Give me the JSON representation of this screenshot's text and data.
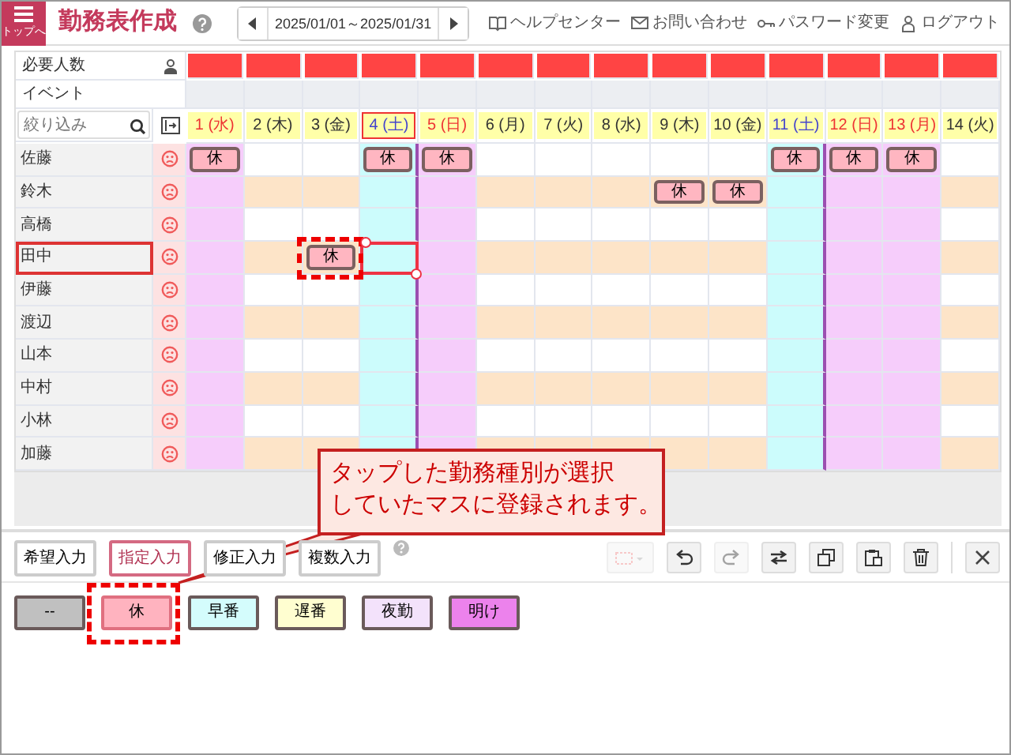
{
  "header": {
    "menu_label": "トップへ",
    "title": "勤務表作成",
    "date_range": "2025/01/01～2025/01/31",
    "links": [
      {
        "label": "ヘルプセンター",
        "kind": "help"
      },
      {
        "label": "お問い合わせ",
        "kind": "mail"
      },
      {
        "label": "パスワード変更",
        "kind": "key"
      },
      {
        "label": "ログアウト",
        "kind": "logout"
      }
    ]
  },
  "grid": {
    "required_label": "必要人数",
    "event_label": "イベント",
    "filter_placeholder": "絞り込み",
    "days": [
      {
        "label": "1 (水)",
        "kind": "holiday",
        "selected": false
      },
      {
        "label": "2 (木)",
        "kind": "weekday",
        "selected": false
      },
      {
        "label": "3 (金)",
        "kind": "weekday",
        "selected": false
      },
      {
        "label": "4 (土)",
        "kind": "saturday",
        "selected": true
      },
      {
        "label": "5 (日)",
        "kind": "sunday",
        "selected": false
      },
      {
        "label": "6 (月)",
        "kind": "weekday",
        "selected": false
      },
      {
        "label": "7 (火)",
        "kind": "weekday",
        "selected": false
      },
      {
        "label": "8 (水)",
        "kind": "weekday",
        "selected": false
      },
      {
        "label": "9 (木)",
        "kind": "weekday",
        "selected": false
      },
      {
        "label": "10 (金)",
        "kind": "weekday",
        "selected": false
      },
      {
        "label": "11 (土)",
        "kind": "saturday",
        "selected": false
      },
      {
        "label": "12 (日)",
        "kind": "sunday",
        "selected": false
      },
      {
        "label": "13 (月)",
        "kind": "holiday",
        "selected": false
      },
      {
        "label": "14 (火)",
        "kind": "weekday",
        "selected": false
      }
    ],
    "staff": [
      {
        "name": "佐藤",
        "selected": false,
        "cells": [
          {
            "kind": "shift",
            "label": "休",
            "highlighted": false
          },
          {
            "kind": "blank"
          },
          {
            "kind": "blank"
          },
          {
            "kind": "shift",
            "label": "休",
            "highlighted": false
          },
          {
            "kind": "shift",
            "label": "休",
            "highlighted": false
          },
          {
            "kind": "blank"
          },
          {
            "kind": "blank"
          },
          {
            "kind": "blank"
          },
          {
            "kind": "blank"
          },
          {
            "kind": "blank"
          },
          {
            "kind": "shift",
            "label": "休",
            "highlighted": false
          },
          {
            "kind": "shift",
            "label": "休",
            "highlighted": false
          },
          {
            "kind": "shift",
            "label": "休",
            "highlighted": false
          },
          {
            "kind": "blank"
          }
        ]
      },
      {
        "name": "鈴木",
        "selected": false,
        "cells": [
          {
            "kind": "blank"
          },
          {
            "kind": "blank"
          },
          {
            "kind": "blank"
          },
          {
            "kind": "blank"
          },
          {
            "kind": "blank"
          },
          {
            "kind": "blank"
          },
          {
            "kind": "blank"
          },
          {
            "kind": "blank"
          },
          {
            "kind": "shift",
            "label": "休",
            "highlighted": false
          },
          {
            "kind": "shift",
            "label": "休",
            "highlighted": false
          },
          {
            "kind": "blank"
          },
          {
            "kind": "blank"
          },
          {
            "kind": "blank"
          },
          {
            "kind": "blank"
          }
        ]
      },
      {
        "name": "高橋",
        "selected": false
      },
      {
        "name": "田中",
        "selected": true,
        "cells": [
          {
            "kind": "blank"
          },
          {
            "kind": "blank"
          },
          {
            "kind": "shift",
            "label": "休",
            "highlighted": true
          },
          {
            "kind": "blank"
          },
          {
            "kind": "blank"
          },
          {
            "kind": "blank"
          },
          {
            "kind": "blank"
          },
          {
            "kind": "blank"
          },
          {
            "kind": "blank"
          },
          {
            "kind": "blank"
          },
          {
            "kind": "blank"
          },
          {
            "kind": "blank"
          },
          {
            "kind": "blank"
          },
          {
            "kind": "blank"
          }
        ]
      },
      {
        "name": "伊藤",
        "selected": false
      },
      {
        "name": "渡辺",
        "selected": false
      },
      {
        "name": "山本",
        "selected": false
      },
      {
        "name": "中村",
        "selected": false
      },
      {
        "name": "小林",
        "selected": false
      },
      {
        "name": "加藤",
        "selected": false
      }
    ]
  },
  "toolbar": {
    "modes": [
      {
        "label": "希望入力",
        "selected": false
      },
      {
        "label": "指定入力",
        "selected": true
      },
      {
        "label": "修正入力",
        "selected": false
      },
      {
        "label": "複数入力",
        "selected": false
      }
    ],
    "tools": [
      {
        "kind": "interval",
        "disabled": true
      },
      {
        "kind": "undo",
        "disabled": false
      },
      {
        "kind": "redo",
        "disabled": true
      },
      {
        "kind": "swap",
        "disabled": false
      },
      {
        "kind": "copy",
        "disabled": false
      },
      {
        "kind": "paste",
        "disabled": false
      },
      {
        "kind": "delete",
        "disabled": false
      },
      {
        "kind": "close",
        "disabled": false
      }
    ]
  },
  "shift_types": [
    {
      "label": "--",
      "color": "#c0c0c0",
      "selected": false,
      "highlighted": false
    },
    {
      "label": "休",
      "color": "#ffb3bf",
      "selected": true,
      "highlighted": true
    },
    {
      "label": "早番",
      "color": "#d4fcfc",
      "selected": false,
      "highlighted": false
    },
    {
      "label": "遅番",
      "color": "#fffed0",
      "selected": false,
      "highlighted": false
    },
    {
      "label": "夜勤",
      "color": "#f3e2fb",
      "selected": false,
      "highlighted": false
    },
    {
      "label": "明け",
      "color": "#ec82ec",
      "selected": false,
      "highlighted": false
    }
  ],
  "callout": {
    "lines": [
      "タップした勤務種別が選択",
      "していたマスに登録されます。"
    ]
  }
}
